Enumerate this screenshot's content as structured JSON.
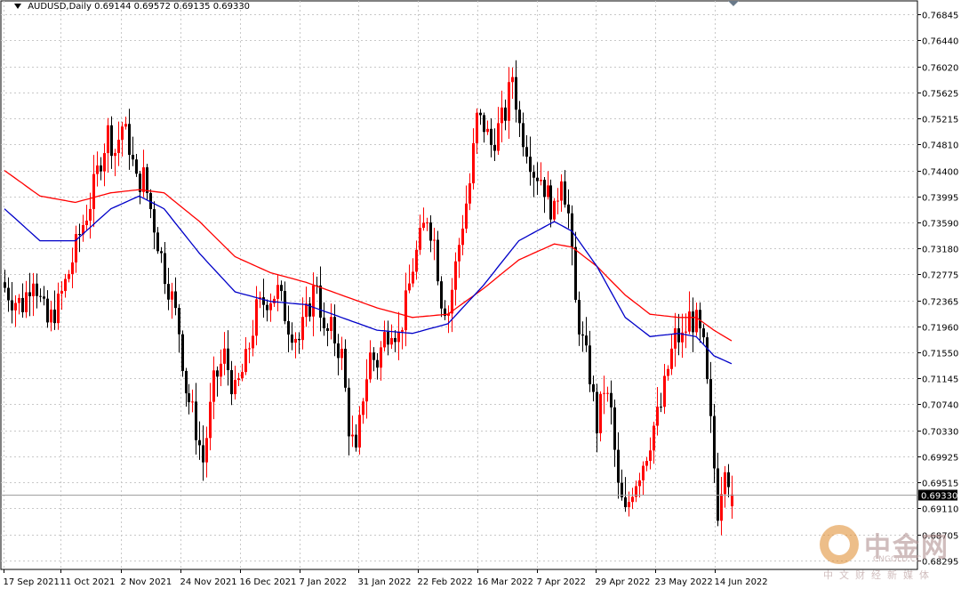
{
  "header": {
    "symbol": "AUDUSD,Daily",
    "ohlc": "0.69144 0.69572 0.69135 0.69330"
  },
  "price_tag": "0.69330",
  "watermark": {
    "title": "中金网",
    "domain": "CNGOLD.CC",
    "subtitle": "中文财经新媒体"
  },
  "colors": {
    "bull_candle": "#ff0000",
    "bear_candle": "#000000",
    "ma_fast": "#0000c8",
    "ma_slow": "#ff0000",
    "grid": "#c8c8c8",
    "price_line": "#a0a0a0"
  },
  "chart_data": {
    "type": "candlestick",
    "title": "AUDUSD,Daily",
    "xlabel": "",
    "ylabel": "",
    "ylim": [
      0.6807,
      0.769
    ],
    "y_ticks": [
      "0.76845",
      "0.76440",
      "0.76020",
      "0.75625",
      "0.75215",
      "0.74810",
      "0.74400",
      "0.73995",
      "0.73590",
      "0.73180",
      "0.72775",
      "0.72365",
      "0.71960",
      "0.71550",
      "0.71145",
      "0.70740",
      "0.70330",
      "0.69925",
      "0.69515",
      "0.69110",
      "0.68705",
      "0.68295"
    ],
    "x_ticks": [
      "17 Sep 2021",
      "11 Oct 2021",
      "2 Nov 2021",
      "24 Nov 2021",
      "16 Dec 2021",
      "7 Jan 2022",
      "31 Jan 2022",
      "22 Feb 2022",
      "16 Mar 2022",
      "7 Apr 2022",
      "29 Apr 2022",
      "23 May 2022",
      "14 Jun 2022"
    ],
    "grid": true,
    "last_price": 0.6933,
    "candle_count": 206,
    "close_anchors": [
      [
        0,
        0.7265
      ],
      [
        3,
        0.724
      ],
      [
        6,
        0.723
      ],
      [
        9,
        0.728
      ],
      [
        11,
        0.7235
      ],
      [
        13,
        0.72
      ],
      [
        16,
        0.723
      ],
      [
        19,
        0.728
      ],
      [
        22,
        0.734
      ],
      [
        25,
        0.739
      ],
      [
        28,
        0.746
      ],
      [
        30,
        0.75
      ],
      [
        32,
        0.747
      ],
      [
        34,
        0.751
      ],
      [
        36,
        0.748
      ],
      [
        38,
        0.742
      ],
      [
        40,
        0.743
      ],
      [
        42,
        0.738
      ],
      [
        44,
        0.733
      ],
      [
        46,
        0.728
      ],
      [
        48,
        0.724
      ],
      [
        50,
        0.719
      ],
      [
        52,
        0.71
      ],
      [
        54,
        0.706
      ],
      [
        57,
        0.6985
      ],
      [
        60,
        0.7105
      ],
      [
        63,
        0.715
      ],
      [
        66,
        0.709
      ],
      [
        69,
        0.714
      ],
      [
        72,
        0.722
      ],
      [
        75,
        0.724
      ],
      [
        78,
        0.725
      ],
      [
        81,
        0.72
      ],
      [
        84,
        0.7175
      ],
      [
        87,
        0.723
      ],
      [
        89,
        0.727
      ],
      [
        91,
        0.718
      ],
      [
        93,
        0.719
      ],
      [
        96,
        0.715
      ],
      [
        98,
        0.704
      ],
      [
        100,
        0.699
      ],
      [
        102,
        0.709
      ],
      [
        104,
        0.715
      ],
      [
        106,
        0.714
      ],
      [
        108,
        0.718
      ],
      [
        110,
        0.72
      ],
      [
        112,
        0.718
      ],
      [
        114,
        0.723
      ],
      [
        116,
        0.729
      ],
      [
        118,
        0.733
      ],
      [
        120,
        0.737
      ],
      [
        122,
        0.733
      ],
      [
        124,
        0.724
      ],
      [
        126,
        0.722
      ],
      [
        128,
        0.729
      ],
      [
        130,
        0.736
      ],
      [
        132,
        0.742
      ],
      [
        134,
        0.752
      ],
      [
        136,
        0.751
      ],
      [
        138,
        0.748
      ],
      [
        140,
        0.7505
      ],
      [
        142,
        0.753
      ],
      [
        144,
        0.759
      ],
      [
        146,
        0.751
      ],
      [
        148,
        0.748
      ],
      [
        150,
        0.744
      ],
      [
        152,
        0.743
      ],
      [
        154,
        0.74
      ],
      [
        156,
        0.737
      ],
      [
        158,
        0.744
      ],
      [
        160,
        0.737
      ],
      [
        162,
        0.723
      ],
      [
        164,
        0.717
      ],
      [
        166,
        0.712
      ],
      [
        168,
        0.704
      ],
      [
        170,
        0.71
      ],
      [
        172,
        0.706
      ],
      [
        174,
        0.694
      ],
      [
        176,
        0.69
      ],
      [
        178,
        0.6945
      ],
      [
        180,
        0.697
      ],
      [
        182,
        0.7
      ],
      [
        184,
        0.704
      ],
      [
        186,
        0.707
      ],
      [
        188,
        0.713
      ],
      [
        190,
        0.718
      ],
      [
        192,
        0.7175
      ],
      [
        194,
        0.721
      ],
      [
        196,
        0.72
      ],
      [
        198,
        0.716
      ],
      [
        200,
        0.704
      ],
      [
        202,
        0.691
      ],
      [
        204,
        0.699
      ],
      [
        206,
        0.6933
      ]
    ],
    "ma_fast_anchors": [
      [
        0,
        0.738
      ],
      [
        10,
        0.733
      ],
      [
        20,
        0.733
      ],
      [
        30,
        0.738
      ],
      [
        38,
        0.74
      ],
      [
        45,
        0.738
      ],
      [
        55,
        0.731
      ],
      [
        65,
        0.725
      ],
      [
        75,
        0.7235
      ],
      [
        85,
        0.723
      ],
      [
        95,
        0.721
      ],
      [
        105,
        0.719
      ],
      [
        115,
        0.7185
      ],
      [
        125,
        0.72
      ],
      [
        135,
        0.726
      ],
      [
        145,
        0.733
      ],
      [
        155,
        0.736
      ],
      [
        160,
        0.7345
      ],
      [
        167,
        0.729
      ],
      [
        175,
        0.721
      ],
      [
        182,
        0.718
      ],
      [
        190,
        0.7185
      ],
      [
        195,
        0.718
      ],
      [
        200,
        0.715
      ],
      [
        206,
        0.7135
      ]
    ],
    "ma_slow_anchors": [
      [
        0,
        0.744
      ],
      [
        10,
        0.74
      ],
      [
        20,
        0.739
      ],
      [
        30,
        0.7405
      ],
      [
        38,
        0.741
      ],
      [
        45,
        0.7405
      ],
      [
        55,
        0.736
      ],
      [
        65,
        0.7305
      ],
      [
        75,
        0.728
      ],
      [
        85,
        0.7265
      ],
      [
        95,
        0.7245
      ],
      [
        105,
        0.7225
      ],
      [
        115,
        0.721
      ],
      [
        125,
        0.7215
      ],
      [
        135,
        0.7255
      ],
      [
        145,
        0.73
      ],
      [
        155,
        0.7325
      ],
      [
        160,
        0.732
      ],
      [
        167,
        0.729
      ],
      [
        175,
        0.7245
      ],
      [
        182,
        0.7215
      ],
      [
        190,
        0.721
      ],
      [
        195,
        0.721
      ],
      [
        200,
        0.719
      ],
      [
        206,
        0.717
      ]
    ]
  }
}
